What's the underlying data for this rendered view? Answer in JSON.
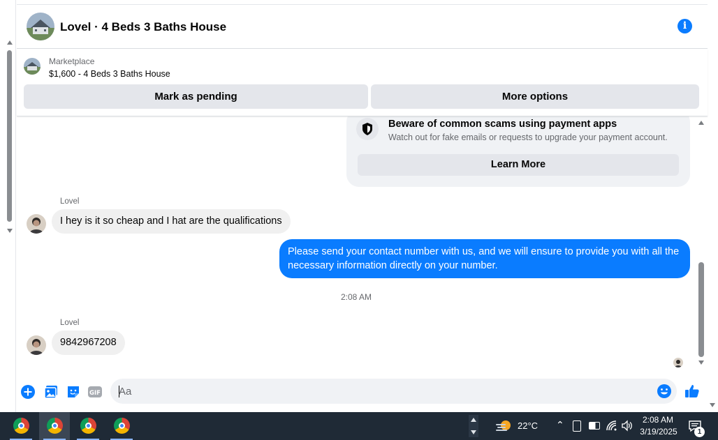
{
  "conversation": {
    "title": "Lovel · 4 Beds 3 Baths House"
  },
  "marketplace": {
    "label": "Marketplace",
    "listing": "$1,600 - 4 Beds 3 Baths House",
    "mark_pending_label": "Mark as pending",
    "more_options_label": "More options"
  },
  "scam_notice": {
    "heading": "Beware of common scams using payment apps",
    "body": "Watch out for fake emails or requests to upgrade your payment account.",
    "learn_more_label": "Learn More"
  },
  "messages": [
    {
      "sender": "Lovel",
      "direction": "incoming",
      "text": "I hey is it so cheap and I hat are the qualifications"
    },
    {
      "direction": "outgoing",
      "text": "Please send your contact number with us, and we will ensure to provide you with all the necessary information directly on your number."
    },
    {
      "type": "timestamp",
      "text": "2:08 AM"
    },
    {
      "sender": "Lovel",
      "direction": "incoming",
      "text": "9842967208"
    }
  ],
  "composer": {
    "placeholder": "Aa",
    "value": ""
  },
  "taskbar": {
    "weather": "22°C",
    "time": "2:08 AM",
    "date": "3/19/2025",
    "notification_count": "1"
  },
  "colors": {
    "accent": "#0a7cff",
    "bubble_incoming": "#f0f0f0",
    "button_gray": "#e4e6eb",
    "taskbar": "#1f2a36"
  }
}
